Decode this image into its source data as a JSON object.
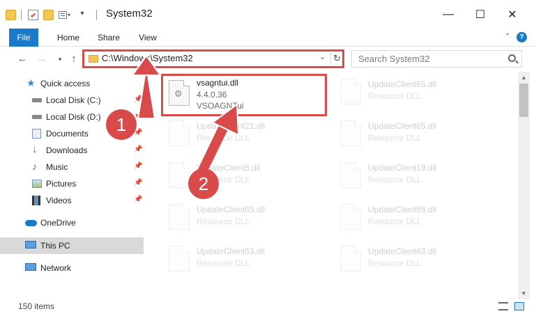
{
  "window": {
    "title": "System32",
    "minimize": "—",
    "maximize": "☐",
    "close": "✕"
  },
  "ribbon": {
    "tabs": [
      "File",
      "Home",
      "Share",
      "View"
    ],
    "collapse_icon": "chevron-up-icon",
    "help_icon": "help-icon"
  },
  "address": {
    "path": "C:\\Windows\\System32",
    "search_placeholder": "Search System32"
  },
  "nav": {
    "items": [
      {
        "label": "Quick access",
        "icon": "star-icon"
      },
      {
        "label": "Local Disk (C:)",
        "icon": "drive-icon"
      },
      {
        "label": "Local Disk (D:)",
        "icon": "drive-icon"
      },
      {
        "label": "Documents",
        "icon": "documents-icon"
      },
      {
        "label": "Downloads",
        "icon": "download-icon"
      },
      {
        "label": "Music",
        "icon": "music-icon"
      },
      {
        "label": "Pictures",
        "icon": "pictures-icon"
      },
      {
        "label": "Videos",
        "icon": "videos-icon"
      },
      {
        "label": "OneDrive",
        "icon": "cloud-icon"
      },
      {
        "label": "This PC",
        "icon": "computer-icon"
      },
      {
        "label": "Network",
        "icon": "network-icon"
      }
    ]
  },
  "files": {
    "highlighted": {
      "name": "vsagntui.dll",
      "version": "4.4.0.36",
      "desc": "VSOAGNTui"
    },
    "col1": [
      {
        "name": "UpdateClient21.dll",
        "desc": "Resource DLL"
      },
      {
        "name": "UpdateClient5.dll",
        "desc": "Resource DLL"
      },
      {
        "name": "UpdateClient65.dll",
        "desc": "Resource DLL"
      },
      {
        "name": "UpdateClient63.dll",
        "desc": "Resource DLL"
      }
    ],
    "col2": [
      {
        "name": "UpdateClient65.dll",
        "desc": "Resource DLL"
      },
      {
        "name": "UpdateClient65.dll",
        "desc": "Resource DLL"
      },
      {
        "name": "UpdateClient19.dll",
        "desc": "Resource DLL"
      },
      {
        "name": "UpdateClient65.dll",
        "desc": "Resource DLL"
      },
      {
        "name": "UpdateClient63.dll",
        "desc": "Resource DLL"
      }
    ]
  },
  "annotations": {
    "step1": "1",
    "step2": "2"
  },
  "status": {
    "count": "150 items"
  },
  "colors": {
    "accent": "#1979ca",
    "annotation": "#d94b4b"
  }
}
